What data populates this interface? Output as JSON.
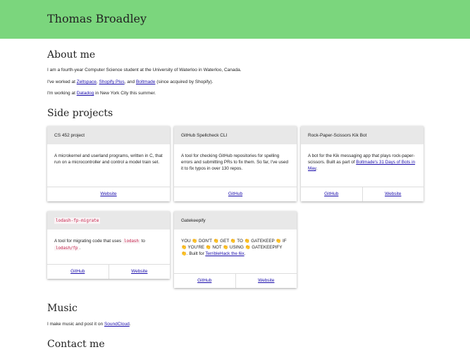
{
  "header": {
    "name": "Thomas Broadley"
  },
  "about": {
    "heading": "About me",
    "line1": "I am a fourth-year Computer Science student at the University of Waterloo in Waterloo, Canada.",
    "line2_prefix": "I've worked at ",
    "zeltspace": "Zeltspace",
    "comma": ", ",
    "shopify_plus": "Shopify Plus",
    "and": ", and ",
    "boltmade": "Boltmade",
    "line2_suffix": " (since acquired by Shopify).",
    "line3_prefix": "I'm working at ",
    "datadog": "Datadog",
    "line3_suffix": " in New York City this summer."
  },
  "projects": {
    "heading": "Side projects",
    "cs452": {
      "title": "CS 452 project",
      "desc": "A microkernel and userland programs, written in C, that run on a microcontroller and control a model train set.",
      "website": "Website"
    },
    "spellcheck": {
      "title": "GitHub Spellcheck CLI",
      "desc": "A tool for checking GitHub repositories for spelling errors and submitting PRs to fix them. So far, I've used it to fix typos in over 130 repos.",
      "github": "GitHub"
    },
    "rps": {
      "title": "Rock-Paper-Scissors Kik Bot",
      "desc_prefix": "A bot for the Kik messaging app that plays rock-paper-scissors. Built as part of ",
      "link": "Boltmade's 31 Days of Bots in May",
      "desc_suffix": ".",
      "github": "GitHub",
      "website": "Website"
    },
    "lodash": {
      "title": "lodash-fp-migrate",
      "desc_prefix": "A tool for migrating code that uses ",
      "code1": "lodash",
      "desc_mid": " to ",
      "code2": "lodash/fp",
      "desc_suffix": ".",
      "github": "GitHub",
      "website": "Website"
    },
    "gatekeepify": {
      "title": "Gatekeepify",
      "desc_prefix": "YOU 👏 DON'T 👏 GET 👏 TO 👏 GATEKEEP 👏 IF 👏 YOU'RE 👏 NOT 👏 USING 👏 GATEKEEPIFY 👏. Built for ",
      "link": "TerribleHack the 6ix",
      "desc_suffix": ".",
      "github": "GitHub",
      "website": "Website"
    }
  },
  "music": {
    "heading": "Music",
    "line_prefix": "I make music and post it on ",
    "soundcloud": "SoundCloud",
    "line_suffix": "."
  },
  "contact": {
    "heading": "Contact me"
  }
}
